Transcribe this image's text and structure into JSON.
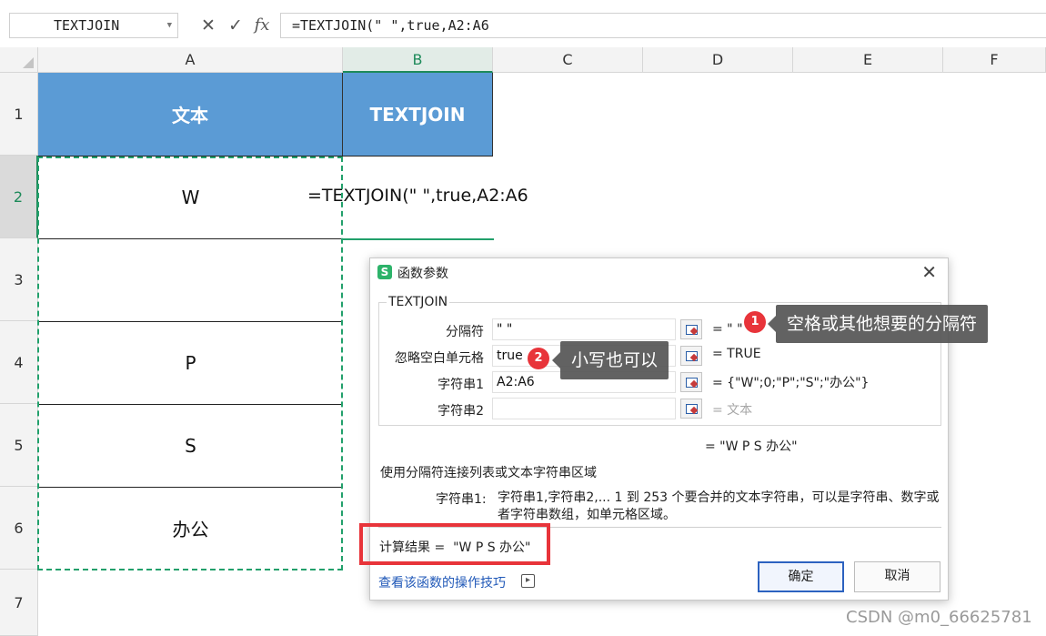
{
  "formula_bar": {
    "name_box": "TEXTJOIN",
    "formula": "=TEXTJOIN(\" \",true,A2:A6"
  },
  "columns": [
    "A",
    "B",
    "C",
    "D",
    "E",
    "F"
  ],
  "rows": [
    "1",
    "2",
    "3",
    "4",
    "5",
    "6",
    "7"
  ],
  "cells": {
    "A1": "文本",
    "B1": "TEXTJOIN",
    "A2": "W",
    "B2_formula": "=TEXTJOIN(\" \",true,A2:A6",
    "A4": "P",
    "A5": "S",
    "A6": "办公"
  },
  "colors": {
    "header_fill": "#5b9bd5",
    "selection": "#22a06b",
    "highlight": "#e8343a"
  },
  "dialog": {
    "title": "函数参数",
    "function_name": "TEXTJOIN",
    "params": [
      {
        "label": "分隔符",
        "value": "\" \"",
        "result": "= \" \""
      },
      {
        "label": "忽略空白单元格",
        "value": "true",
        "result": "= TRUE"
      },
      {
        "label": "字符串1",
        "value": "A2:A6",
        "result": "= {\"W\";0;\"P\";\"S\";\"办公\"}"
      },
      {
        "label": "字符串2",
        "value": "",
        "result": "= 文本"
      }
    ],
    "total_result": "= \"W P S 办公\"",
    "description": "使用分隔符连接列表或文本字符串区域",
    "arg_name": "字符串1:",
    "arg_desc": "字符串1,字符串2,... 1 到 253 个要合并的文本字符串，可以是字符串、数字或者字符串数组，如单元格区域。",
    "calc_result": "计算结果 =  \"W P S 办公\"",
    "help_link": "查看该函数的操作技巧",
    "ok": "确定",
    "cancel": "取消"
  },
  "annotations": [
    {
      "badge": "1",
      "text": "空格或其他想要的分隔符"
    },
    {
      "badge": "2",
      "text": "小写也可以"
    }
  ],
  "watermark": "CSDN @m0_66625781"
}
